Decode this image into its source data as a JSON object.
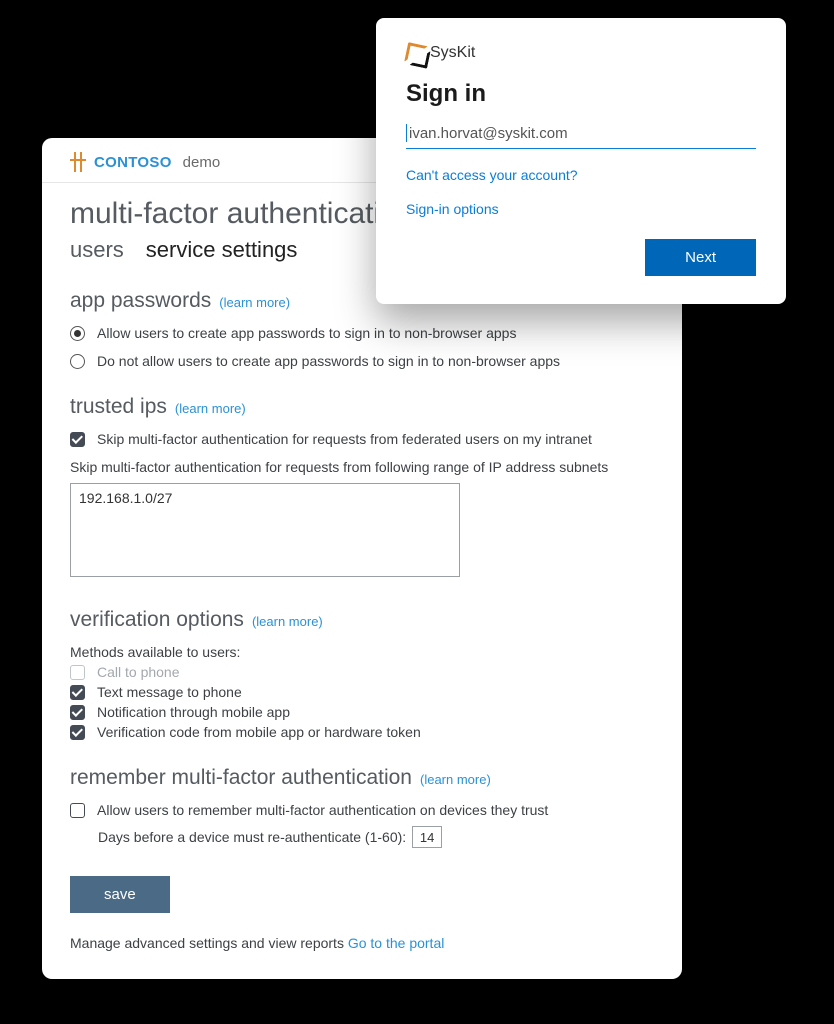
{
  "brand": {
    "strong": "CONTOSO",
    "light": "demo"
  },
  "pageTitle": "multi-factor authentication",
  "tabs": {
    "users": "users",
    "serviceSettings": "service settings"
  },
  "learnMore": "learn more",
  "appPasswords": {
    "title": "app passwords",
    "allow": "Allow users to create app passwords to sign in to non-browser apps",
    "deny": "Do not allow users to create app passwords to sign in to non-browser apps"
  },
  "trustedIps": {
    "title": "trusted ips",
    "skipFederated": "Skip multi-factor authentication for requests from federated users on my intranet",
    "subnetLabel": "Skip multi-factor authentication for requests from following range of IP address subnets",
    "subnets": "192.168.1.0/27"
  },
  "verification": {
    "title": "verification options",
    "methodsLabel": "Methods available to users:",
    "methods": [
      {
        "label": "Call to phone",
        "checked": false,
        "disabled": true
      },
      {
        "label": "Text message to phone",
        "checked": true,
        "disabled": false
      },
      {
        "label": "Notification through mobile app",
        "checked": true,
        "disabled": false
      },
      {
        "label": "Verification code from mobile app or hardware token",
        "checked": true,
        "disabled": false
      }
    ]
  },
  "remember": {
    "title": "remember multi-factor authentication",
    "allow": "Allow users to remember multi-factor authentication on devices they trust",
    "daysLabel": "Days before a device must re-authenticate (1-60):",
    "days": "14"
  },
  "saveLabel": "save",
  "footer": {
    "text": "Manage advanced settings and view reports ",
    "linkText": "Go to the portal"
  },
  "modal": {
    "brand": "SysKit",
    "heading": "Sign in",
    "email": "ivan.horvat@syskit.com",
    "cantAccess": "Can't access your account?",
    "signinOptions": "Sign-in options",
    "next": "Next"
  }
}
